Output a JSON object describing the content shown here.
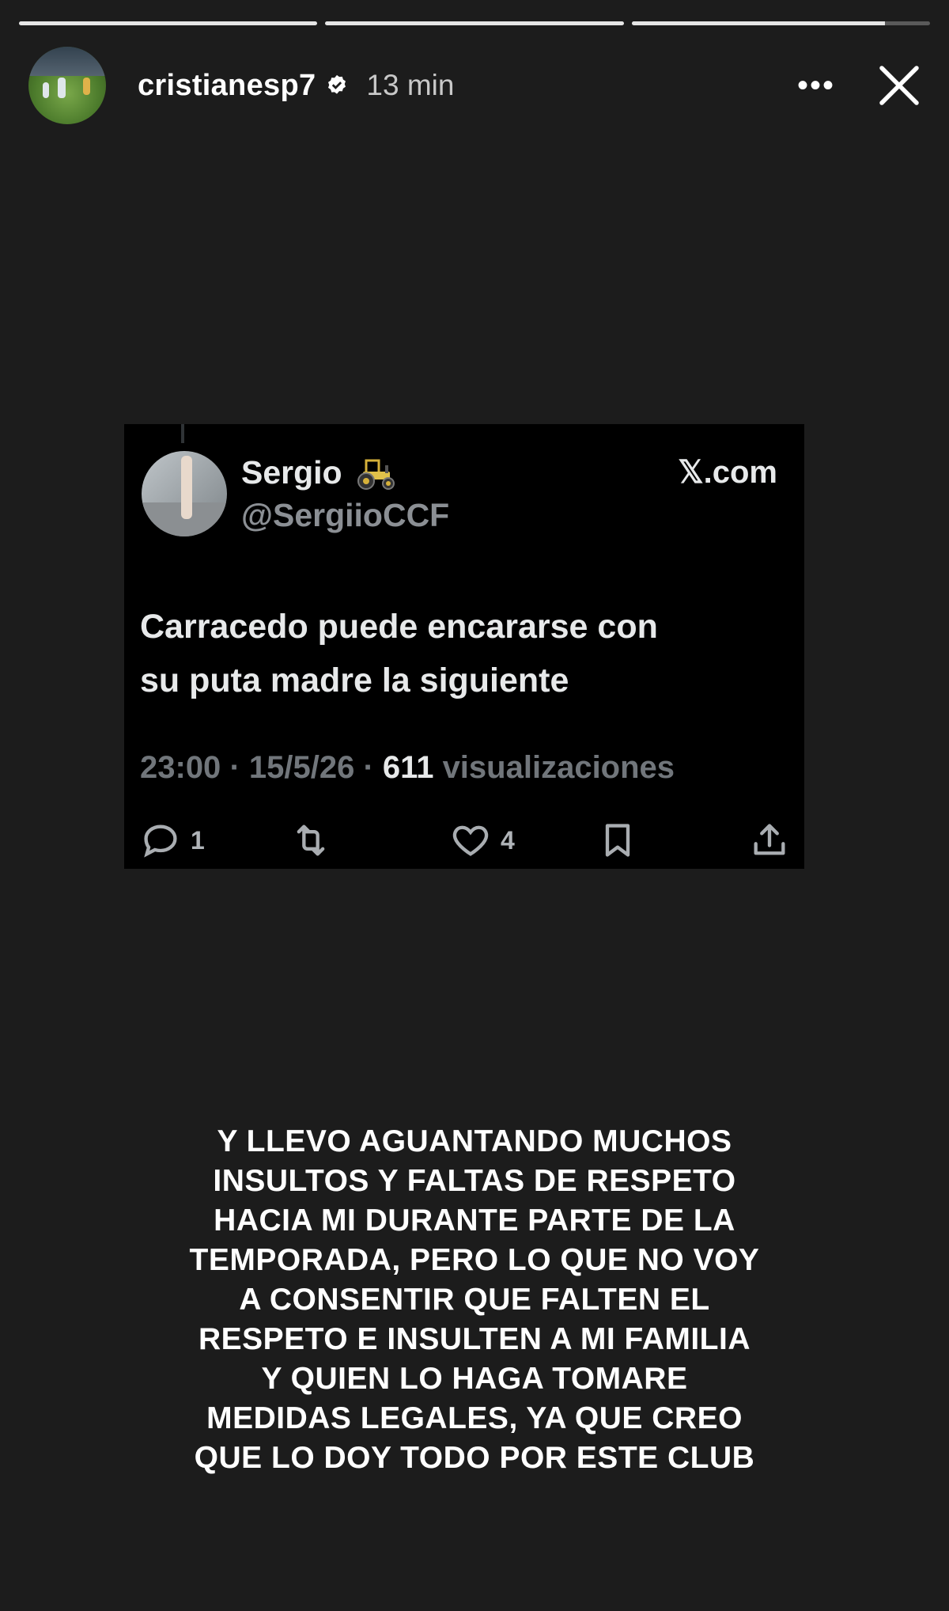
{
  "story": {
    "progress": [
      1,
      1,
      0.85
    ],
    "username": "cristianesp7",
    "time_ago": "13 min",
    "more_label": "•••"
  },
  "tweet": {
    "name": "Sergio",
    "handle": "@SergiioCCF",
    "source": "𝕏.com",
    "text_lines": [
      "Carracedo puede encararse con",
      "su puta madre la siguiente"
    ],
    "time": "23:00",
    "date": "15/5/26",
    "views_count": "611",
    "views_label": "visualizaciones",
    "replies": "1",
    "likes": "4"
  },
  "caption_lines": [
    "Y LLEVO AGUANTANDO MUCHOS",
    "INSULTOS Y FALTAS DE RESPETO",
    "HACIA MI DURANTE PARTE DE LA",
    "TEMPORADA, PERO LO QUE NO VOY",
    "A CONSENTIR QUE FALTEN EL",
    "RESPETO E INSULTEN A MI FAMILIA",
    "Y QUIEN LO HAGA TOMARE",
    "MEDIDAS LEGALES, YA QUE CREO",
    "QUE LO DOY TODO POR ESTE CLUB"
  ]
}
